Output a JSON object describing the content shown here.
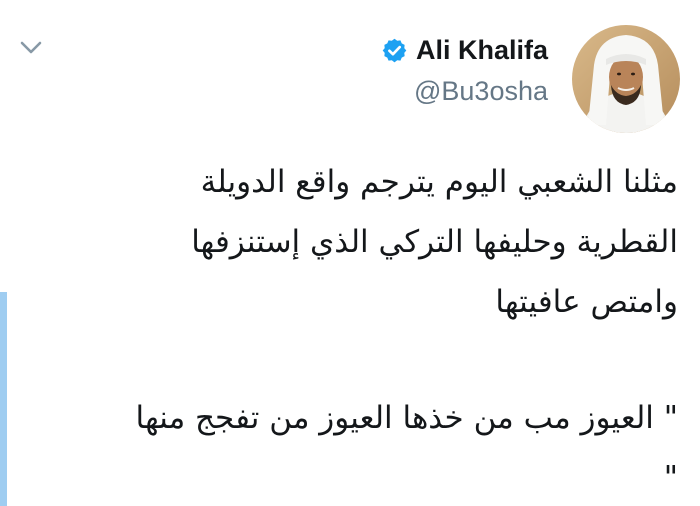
{
  "tweet": {
    "author": {
      "display_name": "Ali Khalifa",
      "handle": "@Bu3osha",
      "verified": true,
      "avatar_icon": "profile-photo"
    },
    "menu_icon": "chevron-down-icon",
    "text_lines": [
      "مثلنا الشعبي اليوم يترجم واقع الدويلة",
      "القطرية وحليفها التركي الذي إستنزفها",
      "وامتص عافيتها",
      "\" العيوز مب من خذها العيوز من تفجج منها",
      "\""
    ]
  },
  "colors": {
    "text": "#14171a",
    "secondary": "#657786",
    "verified_blue": "#1da1f2",
    "caret": "#8899a6",
    "edge_bar": "#9fcdf1"
  }
}
